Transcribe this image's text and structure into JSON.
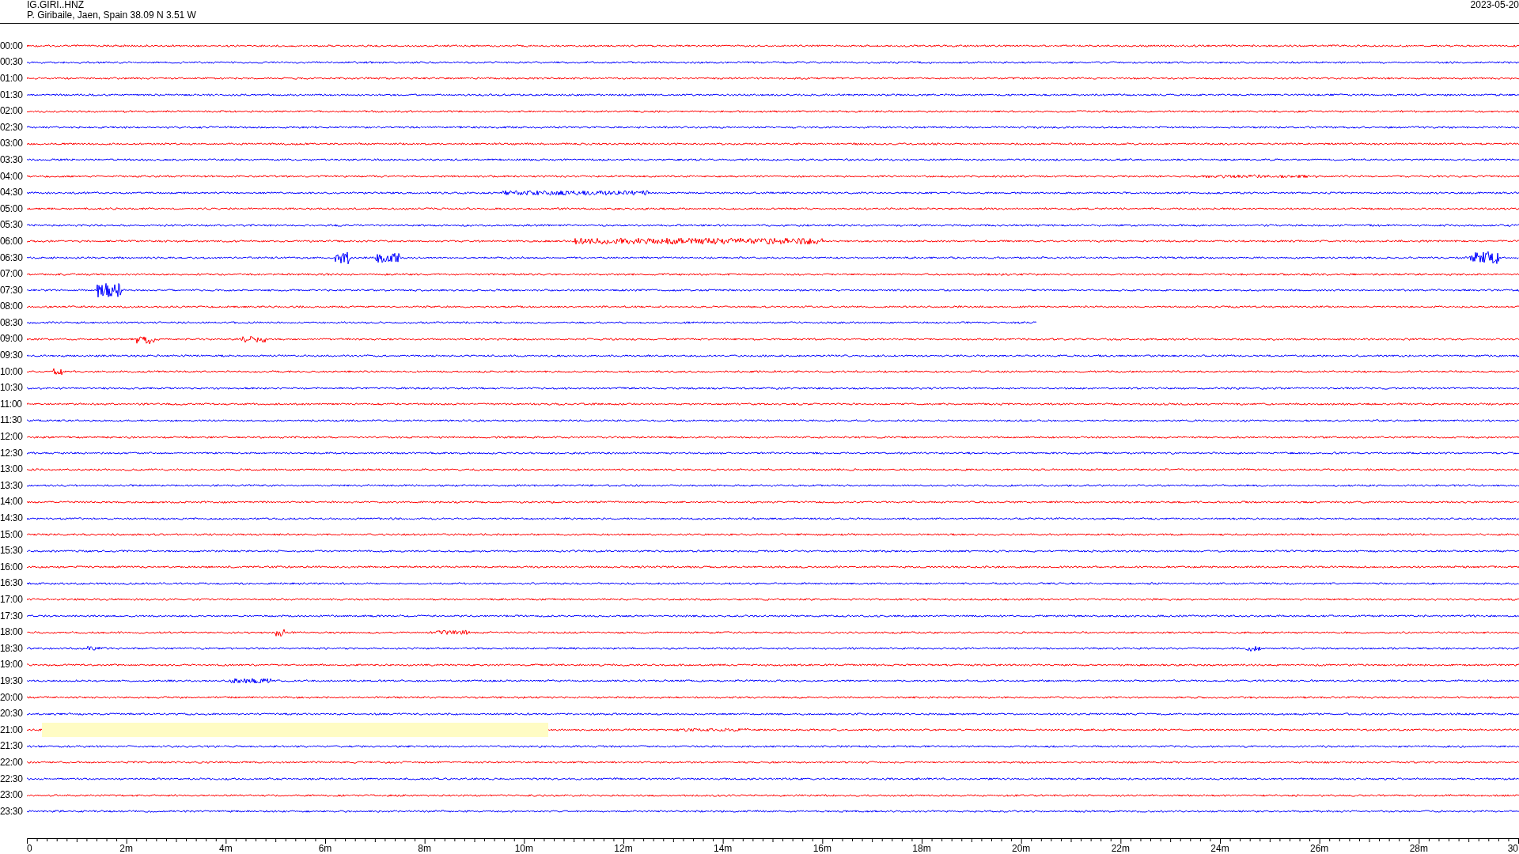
{
  "header": {
    "station": "IG.GIRI..HNZ",
    "location": "P. Giribaile, Jaen, Spain  38.09 N 3.51 W",
    "date": "2023-05-20"
  },
  "traces": [
    {
      "time": "00:00",
      "color": "#ff0000",
      "level": 1,
      "highlighted": false
    },
    {
      "time": "00:30",
      "color": "#0000ff",
      "level": 1,
      "highlighted": false
    },
    {
      "time": "01:00",
      "color": "#ff0000",
      "level": 1,
      "highlighted": false
    },
    {
      "time": "01:30",
      "color": "#0000ff",
      "level": 1,
      "highlighted": false
    },
    {
      "time": "02:00",
      "color": "#ff0000",
      "level": 1,
      "highlighted": false
    },
    {
      "time": "02:30",
      "color": "#0000ff",
      "level": 1,
      "highlighted": false
    },
    {
      "time": "03:00",
      "color": "#ff0000",
      "level": 1,
      "highlighted": false
    },
    {
      "time": "03:30",
      "color": "#0000ff",
      "level": 1,
      "highlighted": false
    },
    {
      "time": "04:00",
      "color": "#ff0000",
      "level": 1,
      "highlighted": false
    },
    {
      "time": "04:30",
      "color": "#0000ff",
      "level": 1,
      "highlighted": false
    },
    {
      "time": "05:00",
      "color": "#ff0000",
      "level": 1,
      "highlighted": false
    },
    {
      "time": "05:30",
      "color": "#0000ff",
      "level": 1,
      "highlighted": false
    },
    {
      "time": "06:00",
      "color": "#ff0000",
      "level": 1,
      "highlighted": false
    },
    {
      "time": "06:30",
      "color": "#0000ff",
      "level": 1,
      "highlighted": false
    },
    {
      "time": "07:00",
      "color": "#ff0000",
      "level": 1,
      "highlighted": false
    },
    {
      "time": "07:30",
      "color": "#0000ff",
      "level": 1,
      "highlighted": false
    },
    {
      "time": "08:00",
      "color": "#ff0000",
      "level": 1,
      "highlighted": false
    },
    {
      "time": "08:30",
      "color": "#0000ff",
      "level": 0.677,
      "highlighted": false
    },
    {
      "time": "09:00",
      "color": "#ff0000",
      "level": 1,
      "highlighted": false
    },
    {
      "time": "09:30",
      "color": "#0000ff",
      "level": 1,
      "highlighted": false
    },
    {
      "time": "10:00",
      "color": "#ff0000",
      "level": 1,
      "highlighted": false
    },
    {
      "time": "10:30",
      "color": "#0000ff",
      "level": 1,
      "highlighted": false
    },
    {
      "time": "11:00",
      "color": "#ff0000",
      "level": 1,
      "highlighted": false
    },
    {
      "time": "11:30",
      "color": "#0000ff",
      "level": 1,
      "highlighted": false
    },
    {
      "time": "12:00",
      "color": "#ff0000",
      "level": 1,
      "highlighted": false
    },
    {
      "time": "12:30",
      "color": "#0000ff",
      "level": 1,
      "highlighted": false
    },
    {
      "time": "13:00",
      "color": "#ff0000",
      "level": 1,
      "highlighted": false
    },
    {
      "time": "13:30",
      "color": "#0000ff",
      "level": 1,
      "highlighted": false
    },
    {
      "time": "14:00",
      "color": "#ff0000",
      "level": 1,
      "highlighted": false
    },
    {
      "time": "14:30",
      "color": "#0000ff",
      "level": 1,
      "highlighted": false
    },
    {
      "time": "15:00",
      "color": "#ff0000",
      "level": 1,
      "highlighted": false
    },
    {
      "time": "15:30",
      "color": "#0000ff",
      "level": 1,
      "highlighted": false
    },
    {
      "time": "16:00",
      "color": "#ff0000",
      "level": 1,
      "highlighted": false
    },
    {
      "time": "16:30",
      "color": "#0000ff",
      "level": 1,
      "highlighted": false
    },
    {
      "time": "17:00",
      "color": "#ff0000",
      "level": 1,
      "highlighted": false
    },
    {
      "time": "17:30",
      "color": "#0000ff",
      "level": 1,
      "highlighted": false
    },
    {
      "time": "18:00",
      "color": "#ff0000",
      "level": 1,
      "highlighted": false
    },
    {
      "time": "18:30",
      "color": "#0000ff",
      "level": 1,
      "highlighted": false
    },
    {
      "time": "19:00",
      "color": "#ff0000",
      "level": 1,
      "highlighted": false
    },
    {
      "time": "19:30",
      "color": "#0000ff",
      "level": 1,
      "highlighted": false
    },
    {
      "time": "20:00",
      "color": "#ff0000",
      "level": 1,
      "highlighted": false
    },
    {
      "time": "20:30",
      "color": "#0000ff",
      "level": 1,
      "highlighted": false
    },
    {
      "time": "21:00",
      "color": "#ff0000",
      "level": 1,
      "highlighted": true
    },
    {
      "time": "21:30",
      "color": "#0000ff",
      "level": 1,
      "highlighted": false
    },
    {
      "time": "22:00",
      "color": "#ff0000",
      "level": 1,
      "highlighted": false
    },
    {
      "time": "22:30",
      "color": "#0000ff",
      "level": 1,
      "highlighted": false
    },
    {
      "time": "23:00",
      "color": "#ff0000",
      "level": 1,
      "highlighted": false
    },
    {
      "time": "23:30",
      "color": "#0000ff",
      "level": 1,
      "highlighted": false
    }
  ],
  "x_axis": {
    "ticks": [
      "0",
      "2m",
      "4m",
      "6m",
      "8m",
      "10m",
      "12m",
      "14m",
      "16m",
      "18m",
      "20m",
      "22m",
      "24m",
      "26m",
      "28m",
      "30"
    ]
  }
}
